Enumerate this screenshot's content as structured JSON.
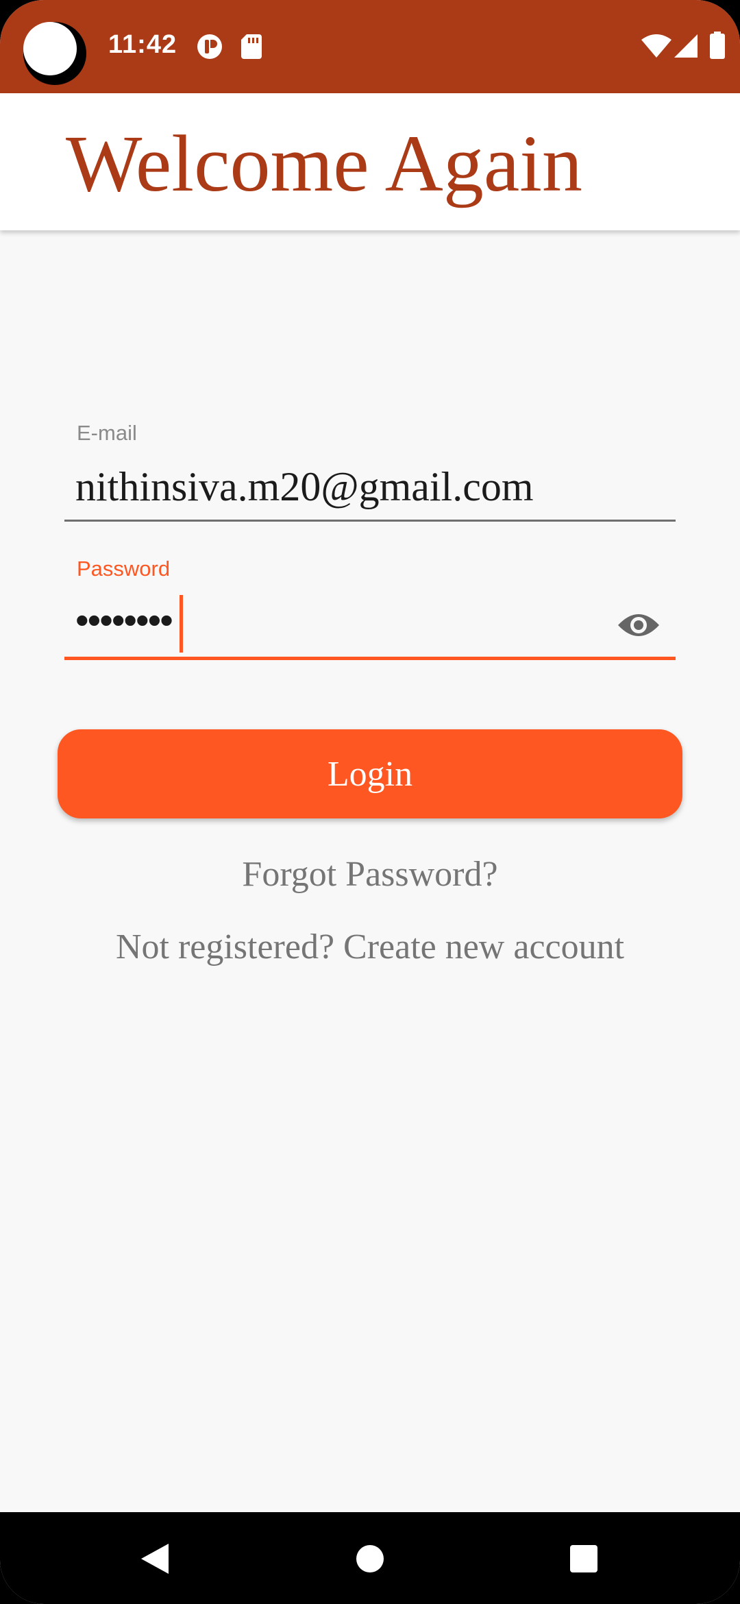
{
  "status_bar": {
    "time": "11:42",
    "icons": [
      "reader-app-icon",
      "sd-card-icon",
      "wifi-icon",
      "cell-signal-icon",
      "battery-icon"
    ]
  },
  "app_bar": {
    "title": "Welcome Again"
  },
  "form": {
    "email": {
      "label": "E-mail",
      "value": "nithinsiva.m20@gmail.com"
    },
    "password": {
      "label": "Password",
      "value": "••••••••"
    },
    "login_label": "Login"
  },
  "links": {
    "forgot_password": "Forgot Password?",
    "register": "Not registered? Create new account"
  },
  "colors": {
    "brand_dark": "#ab3a17",
    "accent": "#ff5722",
    "background": "#f8f8f8",
    "muted_text": "#757575"
  },
  "nav_bar": {
    "icons": [
      "back-icon",
      "home-icon",
      "recents-icon"
    ]
  }
}
